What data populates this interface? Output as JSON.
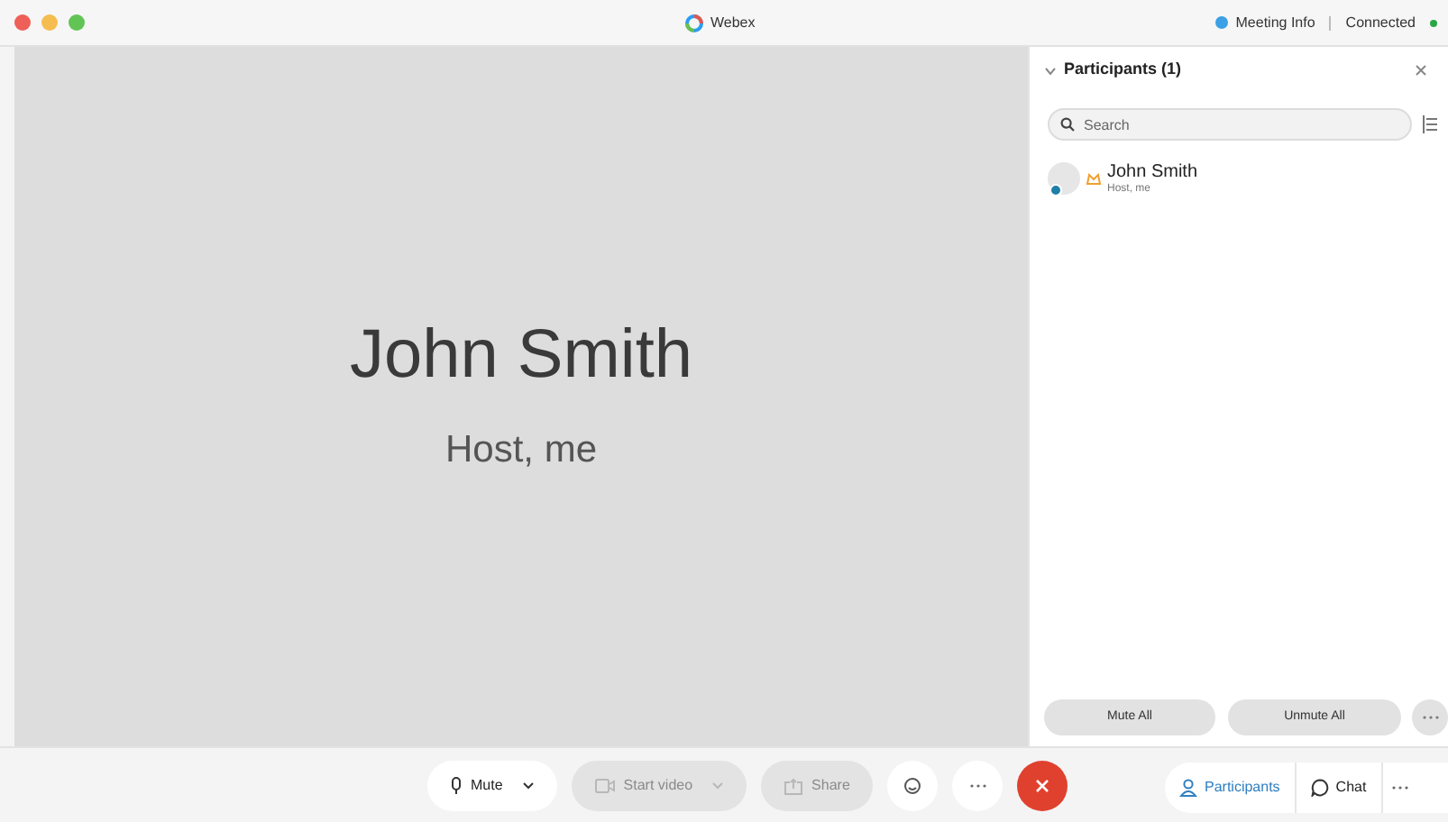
{
  "window": {
    "title": "Webex",
    "meeting_info": "Meeting Info",
    "connection": "Connected"
  },
  "stage": {
    "name": "John Smith",
    "role": "Host, me"
  },
  "participants_panel": {
    "title": "Participants (1)",
    "search": {
      "placeholder": "Search"
    },
    "participants": [
      {
        "name": "John Smith",
        "role": "Host, me"
      }
    ],
    "buttons": [
      {
        "label": "Mute All"
      },
      {
        "label": "Unmute All"
      }
    ]
  },
  "toolbar": {
    "controls": [
      {
        "label": "Mute",
        "kind": "mic",
        "disabled": false
      },
      {
        "label": "Start video",
        "kind": "video",
        "disabled": true
      },
      {
        "label": "Share",
        "kind": "share",
        "disabled": true
      }
    ]
  },
  "panel_tabs": [
    {
      "label": "Participants",
      "selected": true
    },
    {
      "label": "Chat",
      "selected": false
    }
  ]
}
